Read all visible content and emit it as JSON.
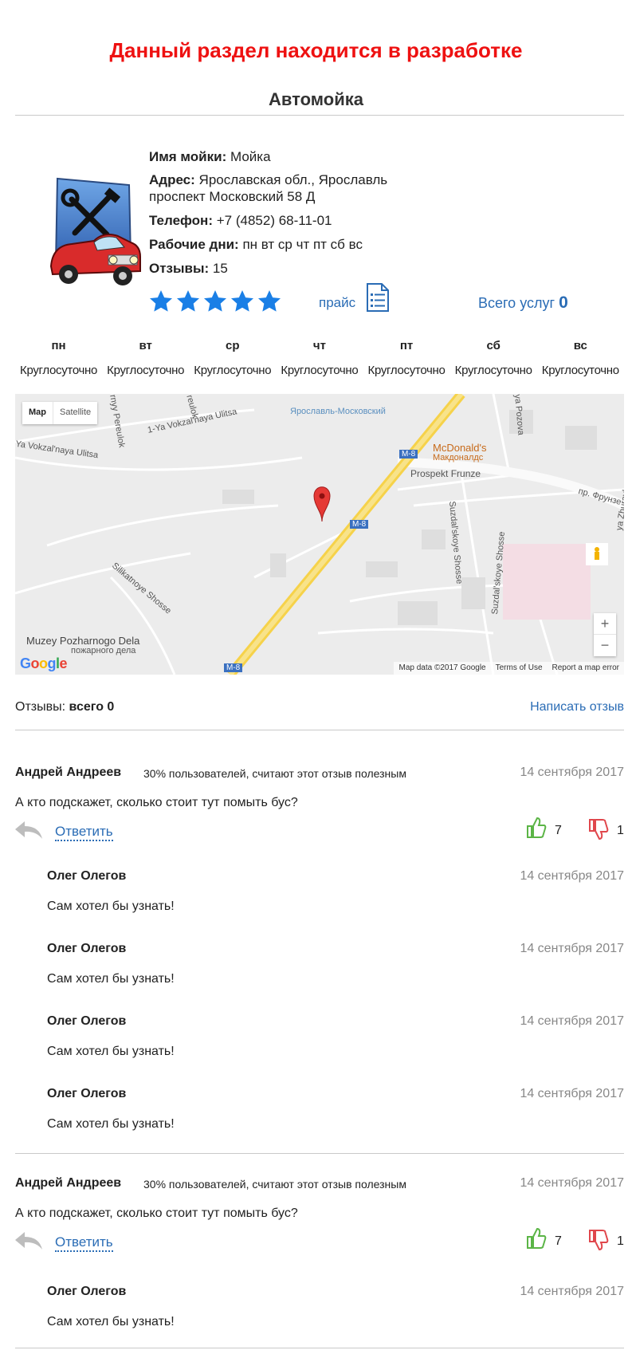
{
  "notice": "Данный раздел находится в разработке",
  "title": "Автомойка",
  "wash": {
    "name_label": "Имя мойки:",
    "name": "Мойка",
    "address_label": "Адрес:",
    "address_line1": "Ярославская обл., Ярославль",
    "address_line2": "проспект Московский 58 Д",
    "phone_label": "Телефон:",
    "phone": "+7 (4852) 68-11-01",
    "days_label": "Рабочие дни:",
    "days": "пн вт ср чт пт сб вс",
    "reviews_label": "Отзывы:",
    "reviews_count": "15",
    "rating": 5,
    "price_label": "прайс",
    "services_label": "Всего услуг",
    "services_count": "0"
  },
  "schedule": [
    {
      "day": "пн",
      "hours": "Круглосуточно"
    },
    {
      "day": "вт",
      "hours": "Круглосуточно"
    },
    {
      "day": "ср",
      "hours": "Круглосуточно"
    },
    {
      "day": "чт",
      "hours": "Круглосуточно"
    },
    {
      "day": "пт",
      "hours": "Круглосуточно"
    },
    {
      "day": "сб",
      "hours": "Круглосуточно"
    },
    {
      "day": "вс",
      "hours": "Круглосуточно"
    }
  ],
  "map": {
    "type_map": "Map",
    "type_satellite": "Satellite",
    "labels": {
      "station": "Ярославль-Московский",
      "mcdonalds": "McDonald's",
      "mcdonalds_ru": "Макдоналдс",
      "prospekt_frunze": "Prospekt Frunze",
      "pr_frunze": "пр. Фрунзе",
      "vokzalnaya": "Ya Vokzal'naya Ulitsa",
      "vokzalnaya1": "1-Ya Vokzal'naya Ulitsa",
      "silikatnoye": "Silikatnoye Shosse",
      "suzdalskoye": "Suzdal'skoye Shosse",
      "suzdalskoye2": "Suzdal'skoye Shosse",
      "muzey": "Muzey Pozharnogo Dela",
      "muzey_ru": "пожарного дела",
      "m8a": "M-8",
      "m8b": "M-8",
      "m8c": "M-8",
      "perulok": "rnyy Pereulok",
      "perulok2": "reulok",
      "pozova": "ya Pozova",
      "zhuravleva": "ya Zhuravleva"
    },
    "zoom_in": "+",
    "zoom_out": "−",
    "footer_data": "Map data ©2017 Google",
    "footer_terms": "Terms of Use",
    "footer_report": "Report a map error",
    "google": "Google"
  },
  "reviews": {
    "label": "Отзывы:",
    "total": "всего 0",
    "write": "Написать отзыв"
  },
  "comments": [
    {
      "author": "Андрей Андреев",
      "useful": "30% пользователей, считают этот отзыв полезным",
      "date": "14 сентября 2017",
      "text": "А кто подскажет, сколько стоит тут помыть бус?",
      "reply": "Ответить",
      "likes": "7",
      "dislikes": "1",
      "replies": [
        {
          "author": "Олег Олегов",
          "date": "14 сентября 2017",
          "text": "Сам хотел бы узнать!"
        },
        {
          "author": "Олег Олегов",
          "date": "14 сентября 2017",
          "text": "Сам хотел бы узнать!"
        },
        {
          "author": "Олег Олегов",
          "date": "14 сентября 2017",
          "text": "Сам хотел бы узнать!"
        },
        {
          "author": "Олег Олегов",
          "date": "14 сентября 2017",
          "text": "Сам хотел бы узнать!"
        }
      ]
    },
    {
      "author": "Андрей Андреев",
      "useful": "30% пользователей, считают этот отзыв полезным",
      "date": "14 сентября 2017",
      "text": "А кто подскажет, сколько стоит тут помыть бус?",
      "reply": "Ответить",
      "likes": "7",
      "dislikes": "1",
      "replies": [
        {
          "author": "Олег Олегов",
          "date": "14 сентября 2017",
          "text": "Сам хотел бы узнать!"
        }
      ]
    }
  ],
  "colors": {
    "notice": "#ee1111",
    "link": "#2a6cb5",
    "star": "#1a7fe6",
    "like": "#5bb546",
    "dislike": "#e0474c"
  }
}
